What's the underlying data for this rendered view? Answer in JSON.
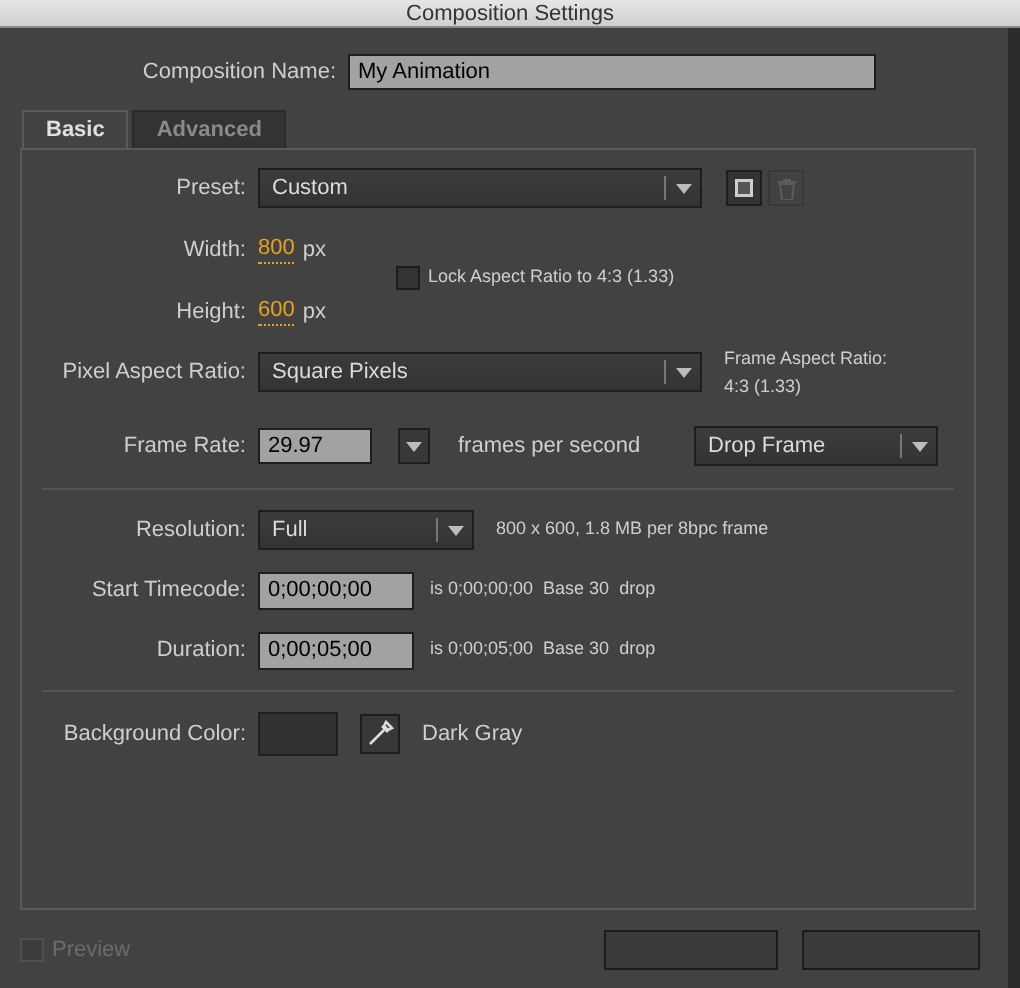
{
  "window": {
    "title": "Composition Settings"
  },
  "composition_name": {
    "label": "Composition Name:",
    "value": "My Animation"
  },
  "tabs": [
    {
      "label": "Basic",
      "selected": true
    },
    {
      "label": "Advanced",
      "selected": false
    }
  ],
  "preset": {
    "label": "Preset:",
    "value": "Custom"
  },
  "width": {
    "label": "Width:",
    "value": "800",
    "unit": "px"
  },
  "lock_aspect": {
    "label": "Lock Aspect Ratio to 4:3 (1.33)",
    "checked": false
  },
  "height": {
    "label": "Height:",
    "value": "600",
    "unit": "px"
  },
  "pixel_aspect": {
    "label": "Pixel Aspect Ratio:",
    "value": "Square Pixels"
  },
  "frame_aspect": {
    "label": "Frame Aspect Ratio:",
    "value": "4:3 (1.33)"
  },
  "frame_rate": {
    "label": "Frame Rate:",
    "value": "29.97",
    "unit": "frames per second",
    "drop": "Drop Frame"
  },
  "resolution": {
    "label": "Resolution:",
    "value": "Full",
    "info": "800 x 600, 1.8 MB per 8bpc frame"
  },
  "start_timecode": {
    "label": "Start Timecode:",
    "value": "0;00;00;00",
    "info": "is 0;00;00;00  Base 30  drop"
  },
  "duration": {
    "label": "Duration:",
    "value": "0;00;05;00",
    "info": "is 0;00;05;00  Base 30  drop"
  },
  "background_color": {
    "label": "Background Color:",
    "color": "#323232",
    "name": "Dark Gray"
  },
  "preview": {
    "label": "Preview",
    "checked": false,
    "disabled": true
  }
}
